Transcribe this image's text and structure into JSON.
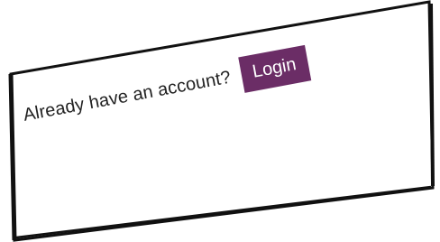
{
  "account_prompt": {
    "text": "Already have an account?",
    "login_label": "Login"
  },
  "colors": {
    "button_bg": "#6b2d66",
    "button_text": "#ffffff",
    "border": "#111111",
    "text": "#222222"
  }
}
